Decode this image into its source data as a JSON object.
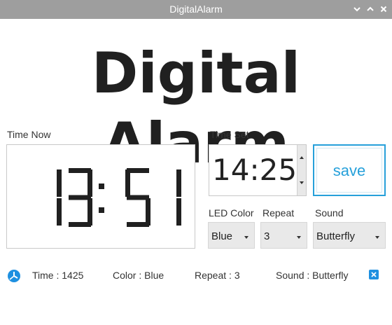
{
  "window": {
    "title": "DigitalAlarm"
  },
  "heading": "Digital Alarm",
  "time_now": {
    "label": "Time Now",
    "hours": "13",
    "minutes": "51"
  },
  "time_set": {
    "label": "Time Set",
    "value": "14:25"
  },
  "save_label": "save",
  "led_color": {
    "label": "LED Color",
    "value": "Blue"
  },
  "repeat": {
    "label": "Repeat",
    "value": "3"
  },
  "sound": {
    "label": "Sound",
    "value": "Butterfly"
  },
  "status": {
    "time": "Time : 1425",
    "color": "Color : Blue",
    "repeat": "Repeat : 3",
    "sound": "Sound : Butterfly"
  },
  "colors": {
    "accent": "#26a0da",
    "titlebar": "#9e9e9e",
    "segment": "#202020"
  },
  "icons": [
    "chevron-down-icon",
    "chevron-up-icon",
    "close-icon",
    "clock-status-icon",
    "remove-icon"
  ]
}
